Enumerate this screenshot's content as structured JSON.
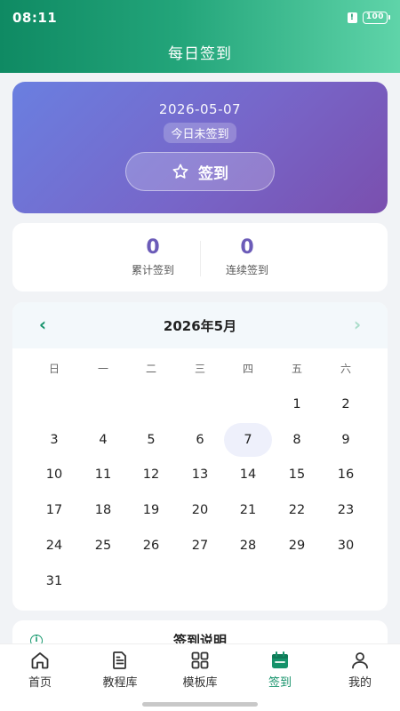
{
  "status_bar": {
    "time": "08:11",
    "sim_glyph": "!",
    "battery": "100"
  },
  "header": {
    "title": "每日签到"
  },
  "hero": {
    "date": "2026-05-07",
    "status": "今日未签到",
    "button_label": "签到",
    "icon": "star-icon"
  },
  "stats": [
    {
      "value": "0",
      "label": "累计签到"
    },
    {
      "value": "0",
      "label": "连续签到"
    }
  ],
  "calendar": {
    "title": "2026年5月",
    "prev": "‹",
    "next": "›",
    "weekdays": [
      "日",
      "一",
      "二",
      "三",
      "四",
      "五",
      "六"
    ],
    "first_weekday": 5,
    "days_in_month": 31,
    "today": 7,
    "days": [
      "1",
      "2",
      "3",
      "4",
      "5",
      "6",
      "7",
      "8",
      "9",
      "10",
      "11",
      "12",
      "13",
      "14",
      "15",
      "16",
      "17",
      "18",
      "19",
      "20",
      "21",
      "22",
      "23",
      "24",
      "25",
      "26",
      "27",
      "28",
      "29",
      "30",
      "31"
    ]
  },
  "notice": {
    "title": "签到说明",
    "icon_glyph": "i"
  },
  "tabs": [
    {
      "label": "首页",
      "icon": "home-icon",
      "active": false
    },
    {
      "label": "教程库",
      "icon": "document-icon",
      "active": false
    },
    {
      "label": "模板库",
      "icon": "grid-icon",
      "active": false
    },
    {
      "label": "签到",
      "icon": "calendar-icon",
      "active": true
    },
    {
      "label": "我的",
      "icon": "user-icon",
      "active": false
    }
  ],
  "colors": {
    "accent": "#15926a",
    "hero_start": "#6a7fe0",
    "hero_end": "#7a4fae",
    "stat_number": "#6b5bb8"
  }
}
